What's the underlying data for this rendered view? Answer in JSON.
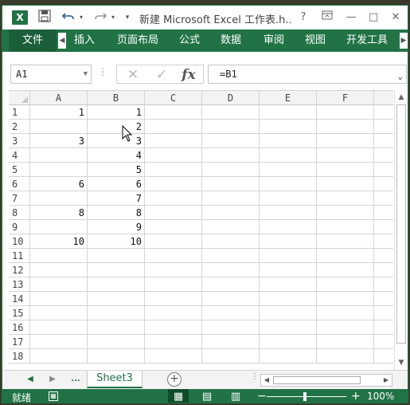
{
  "titlebar": {
    "logo_text": "X",
    "title": "新建 Microsoft Excel 工作表.h...",
    "help": "?",
    "restore_icon": "ribbon-display-icon",
    "minimize": "—",
    "maximize": "□",
    "close": "✕"
  },
  "ribbon": {
    "file": "文件",
    "tabs": [
      "插入",
      "页面布局",
      "公式",
      "数据",
      "审阅",
      "视图",
      "开发工具"
    ]
  },
  "formula_bar": {
    "name_box": "A1",
    "formula": "=B1",
    "fx": "fx"
  },
  "sheet": {
    "columns": [
      "A",
      "B",
      "C",
      "D",
      "E",
      "F"
    ],
    "rows": [
      "1",
      "2",
      "3",
      "4",
      "5",
      "6",
      "7",
      "8",
      "9",
      "10",
      "11",
      "12",
      "13",
      "14",
      "15",
      "16",
      "17",
      "18"
    ],
    "cells": [
      [
        "1",
        "1"
      ],
      [
        "",
        "2"
      ],
      [
        "3",
        "3"
      ],
      [
        "",
        "4"
      ],
      [
        "",
        "5"
      ],
      [
        "6",
        "6"
      ],
      [
        "",
        "7"
      ],
      [
        "8",
        "8"
      ],
      [
        "",
        "9"
      ],
      [
        "10",
        "10"
      ],
      [
        "",
        ""
      ],
      [
        "",
        ""
      ],
      [
        "",
        ""
      ],
      [
        "",
        ""
      ],
      [
        "",
        ""
      ],
      [
        "",
        ""
      ],
      [
        "",
        ""
      ],
      [
        "",
        ""
      ]
    ]
  },
  "sheet_tabs": {
    "active": "Sheet3",
    "more": "...",
    "add": "+"
  },
  "status": {
    "ready": "就绪",
    "zoom": "100%",
    "zoom_value_percent": 100
  },
  "colors": {
    "accent": "#217346",
    "gridline": "#d4d4d4"
  }
}
